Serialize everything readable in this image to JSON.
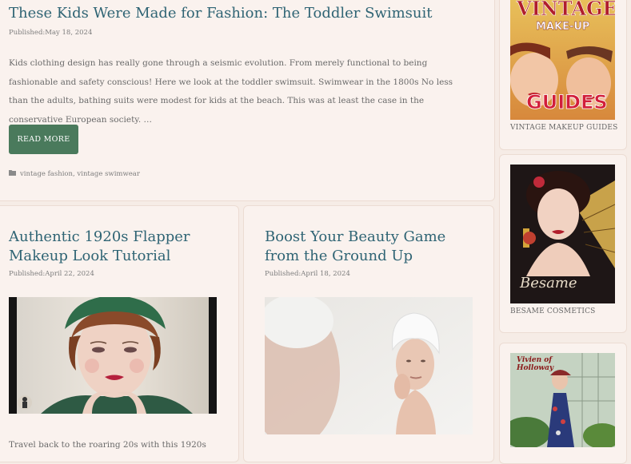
{
  "posts": [
    {
      "title": "These Kids Were Made for Fashion: The Toddler Swimsuit",
      "date": "Published:May 18, 2024",
      "excerpt": "Kids clothing design has really gone through a seismic evolution. From merely functional to being fashionable and safety conscious! Here we look at the toddler swimsuit. Swimwear in the 1800s No less than the adults, bathing suits were modest for kids at the beach. This was at least the case in the conservative European society. …",
      "read_more": "READ MORE",
      "tags": [
        "vintage fashion",
        "vintage swimwear"
      ]
    },
    {
      "title": "Authentic 1920s Flapper Makeup Look Tutorial",
      "date": "Published:April 22, 2024",
      "excerpt": "Travel back to the roaring 20s with this 1920s"
    },
    {
      "title": "Boost Your Beauty Game from the Ground Up",
      "date": "Published:April 18, 2024"
    }
  ],
  "sidebar": {
    "ad1": {
      "lines": [
        "VINTAGE",
        "MAKE-UP",
        "GUIDES"
      ],
      "caption": "VINTAGE MAKEUP GUIDES"
    },
    "ad2": {
      "logo": "Besame",
      "caption": "BESAME COSMETICS"
    },
    "ad3": {
      "logo": "Vivien of Holloway"
    }
  },
  "colors": {
    "title": "#2f6474",
    "button": "#4a7a5c",
    "card_bg": "#faf2ee",
    "page_bg": "#f6ece6"
  }
}
